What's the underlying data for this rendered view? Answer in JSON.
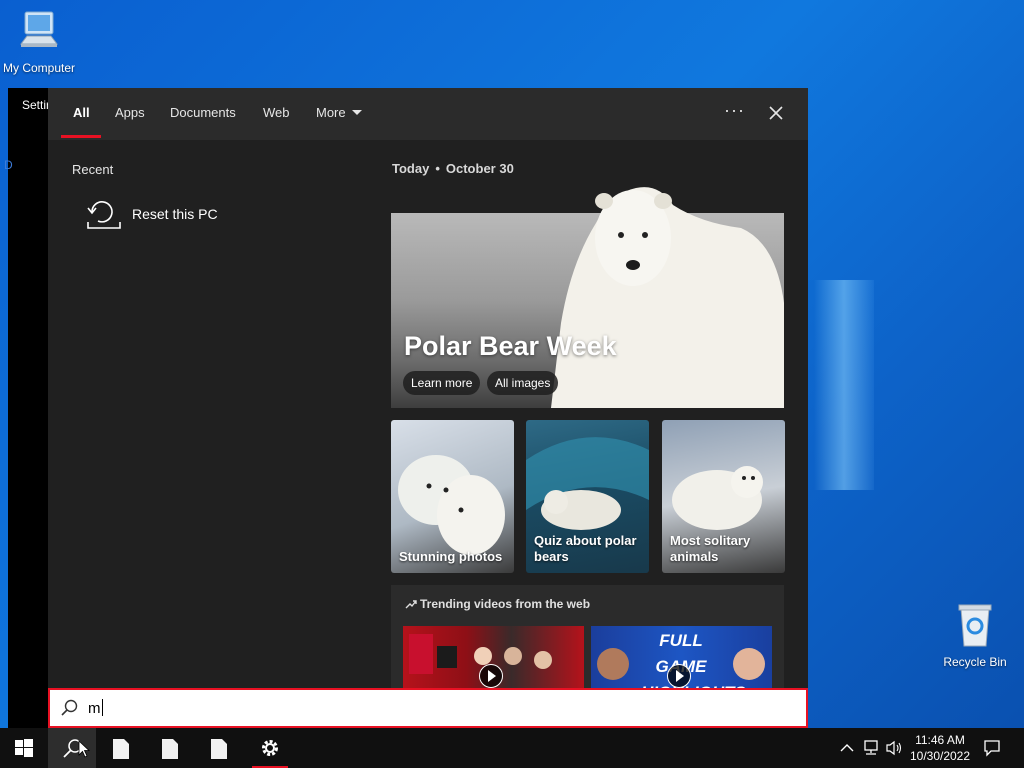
{
  "desktop": {
    "icons": [
      {
        "label": "My Computer"
      },
      {
        "label": "Recycle Bin"
      }
    ],
    "background_window_title": "Settir",
    "background_window_fragment": "D"
  },
  "search_panel": {
    "tabs": [
      {
        "label": "All",
        "active": true
      },
      {
        "label": "Apps"
      },
      {
        "label": "Documents"
      },
      {
        "label": "Web"
      },
      {
        "label": "More"
      }
    ],
    "options_label": "···",
    "recent": {
      "heading": "Recent",
      "items": [
        {
          "label": "Reset this PC",
          "icon": "reset-pc-icon"
        }
      ]
    },
    "today": {
      "label": "Today",
      "date": "October 30"
    },
    "hero": {
      "title": "Polar Bear Week",
      "buttons": [
        "Learn more",
        "All images"
      ]
    },
    "cards": [
      {
        "caption": "Stunning photos"
      },
      {
        "caption": "Quiz about polar bears"
      },
      {
        "caption": "Most solitary animals"
      }
    ],
    "trending": {
      "heading": "Trending videos from the web",
      "videos": [
        {
          "overlay": ""
        },
        {
          "overlay": "FULL GAME HIGHLIGHTS"
        }
      ]
    }
  },
  "search": {
    "query": "m"
  },
  "taskbar": {
    "clock_time": "11:46 AM",
    "clock_date": "10/30/2022"
  },
  "colors": {
    "accent": "#e81123",
    "panel": "#202020",
    "tabbar": "#2b2b2b"
  }
}
